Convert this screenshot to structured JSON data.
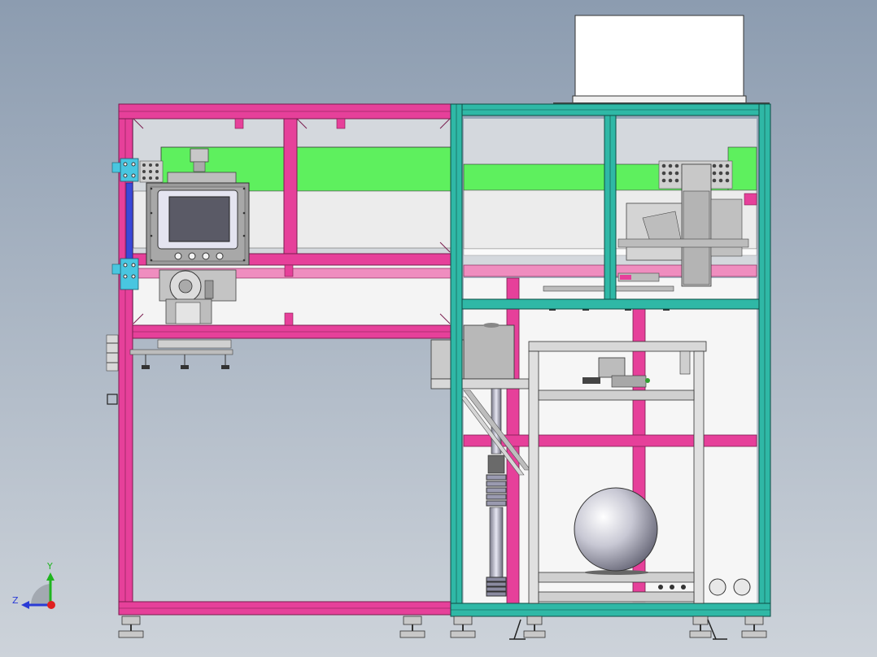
{
  "viewport": {
    "background_top": "#8c9cb0",
    "background_bottom": "#cdd3da"
  },
  "colors": {
    "magenta_frame": "#e6409a",
    "magenta_dark": "#b02a72",
    "teal_frame": "#2fb8a6",
    "teal_dark": "#157a6c",
    "green_panel": "#5ef05e",
    "gray_part": "#b5b5b5",
    "gray_dark": "#6c6c6c",
    "white_part": "#f5f5f5",
    "blue_rail": "#3a48d8",
    "cyan_bracket": "#49c6e0"
  },
  "triad": {
    "y_label": "Y",
    "z_label": "Z",
    "y_color": "#1fb41f",
    "z_color": "#2a3bd6",
    "x_color": "#e02020"
  }
}
